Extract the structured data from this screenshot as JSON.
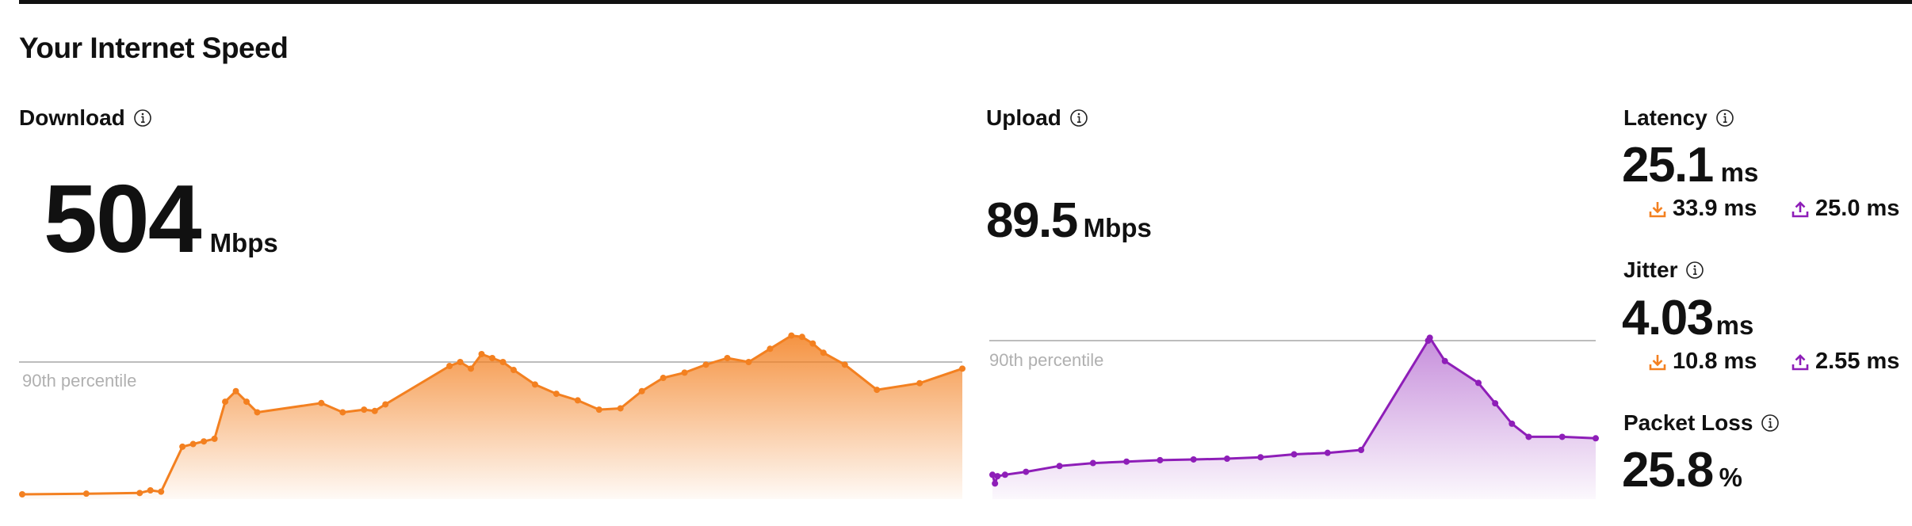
{
  "page_title": "Your Internet Speed",
  "download": {
    "label": "Download",
    "value": "504",
    "unit": "Mbps",
    "percentile_label": "90th percentile",
    "color": "#F38020"
  },
  "upload": {
    "label": "Upload",
    "value": "89.5",
    "unit": "Mbps",
    "percentile_label": "90th percentile",
    "color": "#8E1EB8"
  },
  "latency": {
    "label": "Latency",
    "value": "25.1",
    "unit": "ms",
    "download_value": "33.9 ms",
    "upload_value": "25.0 ms"
  },
  "jitter": {
    "label": "Jitter",
    "value": "4.03",
    "unit": "ms",
    "download_value": "10.8 ms",
    "upload_value": "2.55 ms"
  },
  "packet_loss": {
    "label": "Packet Loss",
    "value": "25.8",
    "unit": "%"
  },
  "icons": [
    "info-icon",
    "download-arrow-icon",
    "upload-arrow-icon"
  ],
  "chart_data": [
    {
      "type": "area",
      "series": [
        {
          "values": [
            0.0,
            0.005,
            0.01,
            0.03,
            0.02,
            0.36,
            0.38,
            0.4,
            0.42,
            0.7,
            0.78,
            0.7,
            0.62,
            0.69,
            0.62,
            0.64,
            0.63,
            0.68,
            0.97,
            1.0,
            0.95,
            1.06,
            1.03,
            1.0,
            0.94,
            0.83,
            0.76,
            0.71,
            0.64,
            0.65,
            0.78,
            0.88,
            0.92,
            0.98,
            1.03,
            1.0,
            1.1,
            1.2,
            1.19,
            1.14,
            1.07,
            0.98,
            0.79,
            0.84,
            0.95
          ]
        }
      ],
      "reference_line": {
        "label": "90th percentile",
        "value": 1.0
      }
    },
    {
      "type": "area",
      "series": [
        {
          "values": [
            0.08,
            0.02,
            0.07,
            0.08,
            0.1,
            0.14,
            0.16,
            0.17,
            0.18,
            0.185,
            0.19,
            0.2,
            0.22,
            0.23,
            0.25,
            1.0,
            1.02,
            0.86,
            0.71,
            0.57,
            0.43,
            0.34,
            0.34,
            0.33
          ]
        }
      ],
      "reference_line": {
        "label": "90th percentile",
        "value": 1.0
      }
    }
  ]
}
